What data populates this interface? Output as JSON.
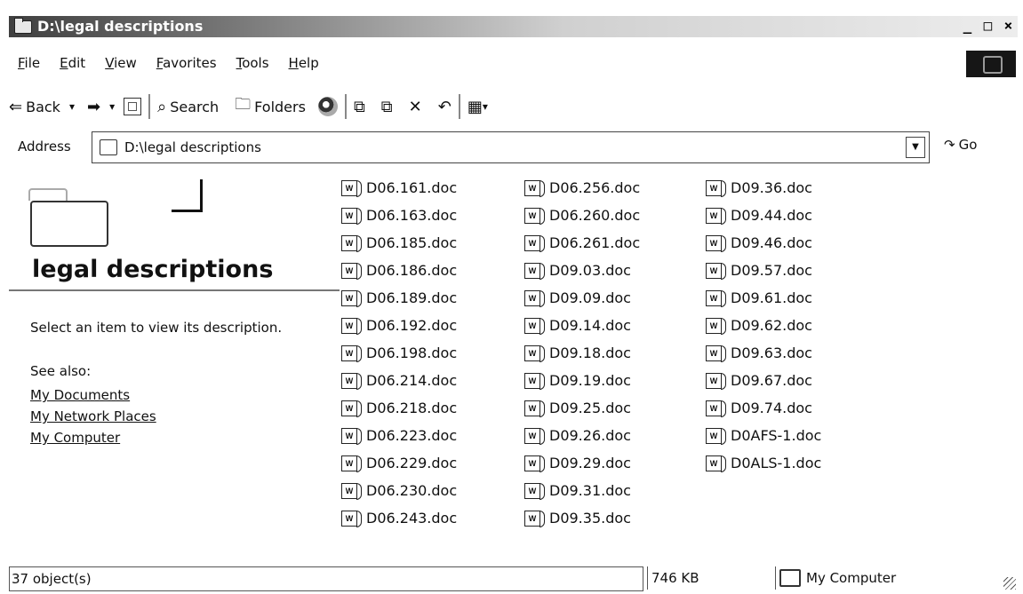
{
  "window": {
    "title": "D:\\legal descriptions",
    "controls": [
      "_",
      "□",
      "×"
    ]
  },
  "menu": [
    "File",
    "Edit",
    "View",
    "Favorites",
    "Tools",
    "Help"
  ],
  "toolbar": {
    "back_label": "Back",
    "search_label": "Search",
    "folders_label": "Folders"
  },
  "address": {
    "label": "Address",
    "value": "D:\\legal descriptions",
    "go_label": "Go"
  },
  "left_panel": {
    "title": "legal descriptions",
    "description": "Select an item to view its description.",
    "see_also": "See also:",
    "links": [
      "My Documents",
      "My Network Places",
      "My Computer"
    ]
  },
  "files": {
    "icon": "word-doc-icon",
    "columns": [
      [
        "D06.161.doc",
        "D06.163.doc",
        "D06.185.doc",
        "D06.186.doc",
        "D06.189.doc",
        "D06.192.doc",
        "D06.198.doc",
        "D06.214.doc",
        "D06.218.doc",
        "D06.223.doc",
        "D06.229.doc",
        "D06.230.doc",
        "D06.243.doc"
      ],
      [
        "D06.256.doc",
        "D06.260.doc",
        "D06.261.doc",
        "D09.03.doc",
        "D09.09.doc",
        "D09.14.doc",
        "D09.18.doc",
        "D09.19.doc",
        "D09.25.doc",
        "D09.26.doc",
        "D09.29.doc",
        "D09.31.doc",
        "D09.35.doc"
      ],
      [
        "D09.36.doc",
        "D09.44.doc",
        "D09.46.doc",
        "D09.57.doc",
        "D09.61.doc",
        "D09.62.doc",
        "D09.63.doc",
        "D09.67.doc",
        "D09.74.doc",
        "D0AFS-1.doc",
        "D0ALS-1.doc"
      ]
    ]
  },
  "status": {
    "count": "37 object(s)",
    "size": "746 KB",
    "zone": "My Computer"
  }
}
